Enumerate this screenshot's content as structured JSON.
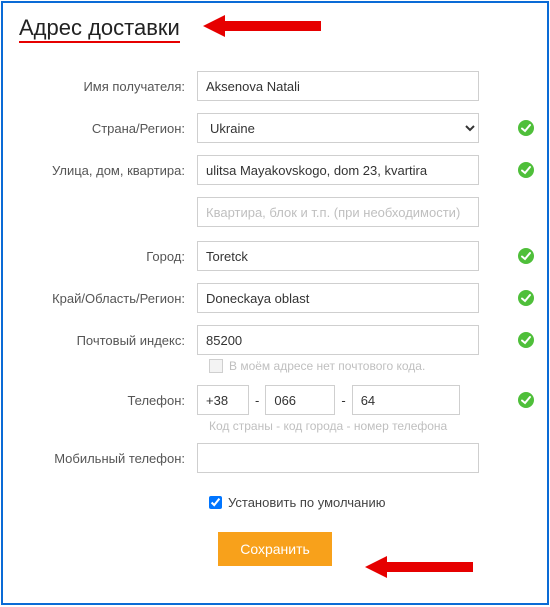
{
  "title": "Адрес доставки",
  "labels": {
    "recipient": "Имя получателя:",
    "country": "Страна/Регион:",
    "street": "Улица, дом, квартира:",
    "city": "Город:",
    "region": "Край/Область/Регион:",
    "zip": "Почтовый индекс:",
    "phone": "Телефон:",
    "mobile": "Мобильный телефон:"
  },
  "values": {
    "recipient": "Aksenova Natali",
    "country": "Ukraine",
    "street": "ulitsa Mayakovskogo, dom 23, kvartira",
    "apt": "",
    "city": "Toretck",
    "region": "Doneckaya oblast",
    "zip": "85200",
    "phone_cc": "+38",
    "phone_city": "066",
    "phone_num": "64",
    "mobile": ""
  },
  "placeholders": {
    "apt": "Квартира, блок и т.п. (при необходимости)"
  },
  "hints": {
    "nozip": "В моём адресе нет почтового кода.",
    "phone": "Код страны - код города - номер телефона"
  },
  "checkbox": {
    "default_label": "Установить по умолчанию"
  },
  "buttons": {
    "save": "Сохранить"
  }
}
